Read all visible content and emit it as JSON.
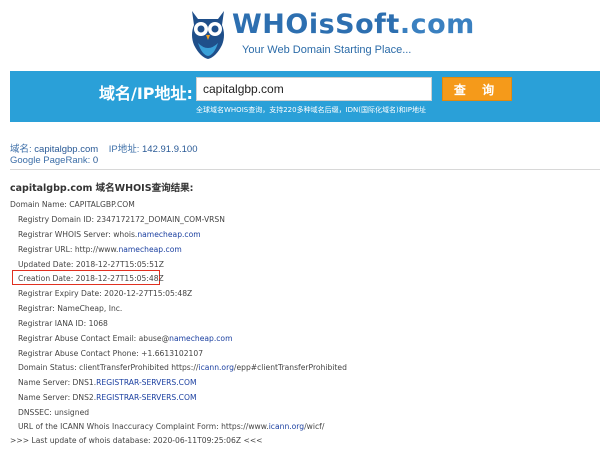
{
  "header": {
    "brand_part1": "WHOisSoft",
    "brand_part2": ".com",
    "tagline": "Your Web Domain Starting Place..."
  },
  "search": {
    "label": "域名/IP地址:",
    "value": "capitalgbp.com",
    "button_label": "查 询",
    "note": "全球域名WHOIS查询，支持220多种域名后缀，IDN(国际化域名)和IP地址"
  },
  "info": {
    "domain_label": "域名:",
    "domain_value": "capitalgbp.com",
    "ip_label": "IP地址:",
    "ip_value": "142.91.9.100",
    "pagerank_label": "Google PageRank:",
    "pagerank_value": "0"
  },
  "result_title": "capitalgbp.com 域名WHOIS查询结果:",
  "whois": {
    "l0": "Domain Name: CAPITALGBP.COM",
    "l1": "Registry Domain ID: 2347172172_DOMAIN_COM-VRSN",
    "l2_pre": "Registrar WHOIS Server: whois.",
    "l2_link": "namecheap.com",
    "l3_pre": "Registrar URL: http://www.",
    "l3_link": "namecheap.com",
    "l4": "Updated Date: 2018-12-27T15:05:51Z",
    "l5": "Creation Date: 2018-12-27T15:05:48Z",
    "l6": "Registrar Expiry Date: 2020-12-27T15:05:48Z",
    "l7": "Registrar: NameCheap, Inc.",
    "l8": "Registrar IANA ID: 1068",
    "l9_pre": "Registrar Abuse Contact Email: abuse@",
    "l9_link": "namecheap.com",
    "l10": "Registrar Abuse Contact Phone: +1.6613102107",
    "l11_pre": "Domain Status: clientTransferProhibited https://",
    "l11_link": "icann.org",
    "l11_post": "/epp#clientTransferProhibited",
    "l12_pre": "Name Server: DNS1.",
    "l12_link": "REGISTRAR-SERVERS.COM",
    "l13_pre": "Name Server: DNS2.",
    "l13_link": "REGISTRAR-SERVERS.COM",
    "l14": "DNSSEC: unsigned",
    "l15_pre": "URL of the ICANN Whois Inaccuracy Complaint Form: https://www.",
    "l15_link": "icann.org",
    "l15_post": "/wicf/",
    "l16": ">>> Last update of whois database: 2020-06-11T09:25:06Z <<<"
  },
  "colors": {
    "band": "#2aa0d8",
    "button": "#f59a1a",
    "highlight": "#e03020",
    "link": "#1a3fa0"
  }
}
